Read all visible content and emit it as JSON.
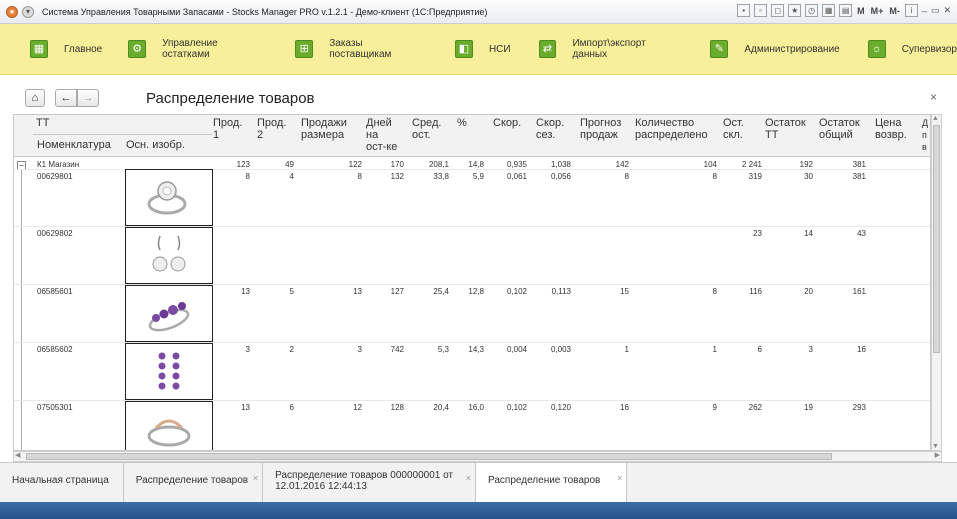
{
  "window": {
    "title": "Система Управления Товарными Запасами - Stocks Manager PRO v.1.2.1 - Демо-клиент  (1С:Предприятие)",
    "right_btns": [
      "M",
      "M+",
      "M-"
    ]
  },
  "menu": [
    {
      "label": "Главное",
      "icon": "grid-icon"
    },
    {
      "label": "Управление остатками",
      "icon": "sections-icon"
    },
    {
      "label": "Заказы поставщикам",
      "icon": "basket-icon"
    },
    {
      "label": "НСИ",
      "icon": "reference-icon"
    },
    {
      "label": "Импорт\\экспорт данных",
      "icon": "transfer-icon"
    },
    {
      "label": "Администрирование",
      "icon": "wrench-icon"
    },
    {
      "label": "Супервизор",
      "icon": "supervisor-icon"
    }
  ],
  "panel": {
    "title": "Распределение товаров",
    "home": "⌂",
    "back": "←",
    "forward": "→",
    "close": "×"
  },
  "table": {
    "group_header": "ТТ",
    "col_nom": "Номенклатура",
    "col_img": "Осн. изобр.",
    "columns": [
      "Прод.\n1",
      "Прод.\n2",
      "Продажи\nразмера",
      "Дней\nна\nост-ке",
      "Сред.\nост.",
      "%",
      "Скор.",
      "Скор.\nсез.",
      "Прогноз\nпродаж",
      "Количество\nраспределено",
      "Ост.\nскл.",
      "Остаток\nТТ",
      "Остаток\nобщий",
      "Цена\nвозвр.",
      "Д\nп\nв"
    ],
    "group_row": {
      "name": "К1 Магазин",
      "values": [
        "123",
        "49",
        "122",
        "170",
        "208,1",
        "14,8",
        "0,935",
        "1,038",
        "142",
        "104",
        "2 241",
        "192",
        "381"
      ]
    },
    "rows": [
      {
        "code": "00629801",
        "values": [
          "8",
          "4",
          "8",
          "132",
          "33,8",
          "5,9",
          "0,061",
          "0,056",
          "8",
          "8",
          "319",
          "30",
          "381"
        ],
        "image": "ring-icon"
      },
      {
        "code": "00629802",
        "values": [
          "",
          "",
          "",
          "",
          "",
          "",
          "",
          "",
          "",
          "",
          "23",
          "14",
          "43"
        ],
        "image": "earrings-icon"
      },
      {
        "code": "06585601",
        "values": [
          "13",
          "5",
          "13",
          "127",
          "25,4",
          "12,8",
          "0,102",
          "0,113",
          "15",
          "8",
          "116",
          "20",
          "161"
        ],
        "image": "amethyst-ring-icon"
      },
      {
        "code": "06585602",
        "values": [
          "3",
          "2",
          "3",
          "742",
          "5,3",
          "14,3",
          "0,004",
          "0,003",
          "1",
          "1",
          "6",
          "3",
          "16"
        ],
        "image": "amethyst-earrings-icon"
      },
      {
        "code": "07505301",
        "values": [
          "13",
          "6",
          "12",
          "128",
          "20,4",
          "16,0",
          "0,102",
          "0,120",
          "16",
          "9",
          "262",
          "19",
          "293"
        ],
        "image": "gold-ring-icon"
      }
    ]
  },
  "tabs": [
    {
      "label": "Начальная страница"
    },
    {
      "label": "Распределение товаров"
    },
    {
      "label": "Распределение товаров 000000001 от\n12.01.2016 12:44:13"
    },
    {
      "label": "Распределение товаров"
    }
  ]
}
